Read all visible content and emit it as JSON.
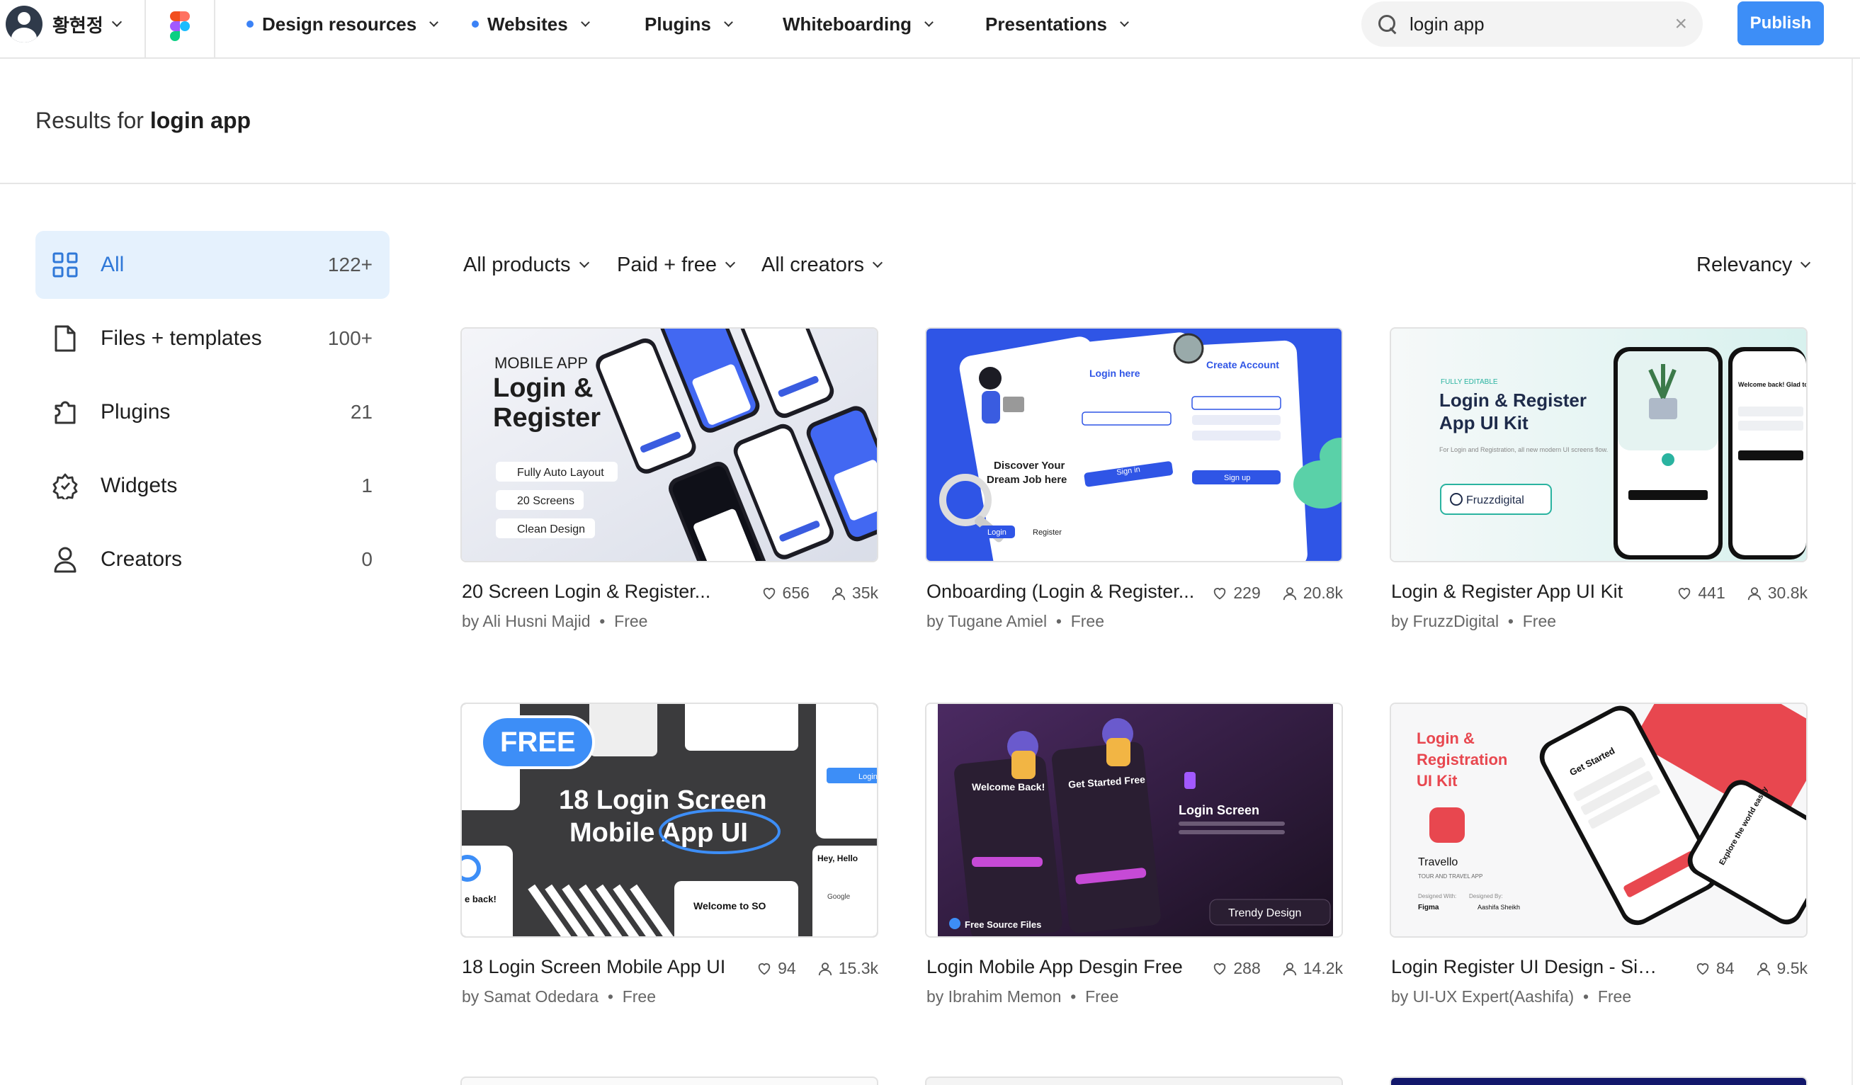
{
  "header": {
    "user_name": "황현정",
    "nav": [
      {
        "label": "Design resources",
        "dot": true
      },
      {
        "label": "Websites",
        "dot": true
      },
      {
        "label": "Plugins",
        "dot": false
      },
      {
        "label": "Whiteboarding",
        "dot": false
      },
      {
        "label": "Presentations",
        "dot": false
      }
    ],
    "search_value": "login app",
    "publish_label": "Publish"
  },
  "results": {
    "prefix": "Results for ",
    "query": "login app"
  },
  "sidebar": {
    "items": [
      {
        "label": "All",
        "count": "122+",
        "icon": "grid-icon",
        "active": true
      },
      {
        "label": "Files + templates",
        "count": "100+",
        "icon": "file-icon",
        "active": false
      },
      {
        "label": "Plugins",
        "count": "21",
        "icon": "plugin-icon",
        "active": false
      },
      {
        "label": "Widgets",
        "count": "1",
        "icon": "widget-icon",
        "active": false
      },
      {
        "label": "Creators",
        "count": "0",
        "icon": "person-icon",
        "active": false
      }
    ]
  },
  "filters": {
    "products": "All products",
    "pricing": "Paid + free",
    "creators": "All creators",
    "sort": "Relevancy"
  },
  "cards": [
    {
      "title": "20 Screen Login & Register...",
      "author": "by Ali Husni Majid",
      "price": "Free",
      "likes": "656",
      "users": "35k",
      "thumb": {
        "kicker": "MOBILE APP",
        "h1": "Login &",
        "h2": "Register",
        "chips": [
          "Fully Auto Layout",
          "20 Screens",
          "Clean Design"
        ]
      }
    },
    {
      "title": "Onboarding (Login & Register...",
      "author": "by Tugane Amiel",
      "price": "Free",
      "likes": "229",
      "users": "20.8k",
      "thumb": {
        "t1": "Discover Your",
        "t2": "Dream Job here",
        "t3": "Login here",
        "t4": "Create Account",
        "b1": "Sign in",
        "b2": "Sign up",
        "b3": "Register",
        "b4": "Login"
      }
    },
    {
      "title": "Login & Register App UI Kit",
      "author": "by FruzzDigital",
      "price": "Free",
      "likes": "441",
      "users": "30.8k",
      "thumb": {
        "kicker": "FULLY EDITABLE",
        "h1": "Login & Register",
        "h2": "App UI Kit",
        "sub": "For Login and Registration, all new modern UI screens flow.",
        "brand": "Fruzzdigital",
        "welcome": "Welcome back! Glad to see you, Again!"
      }
    },
    {
      "title": "18 Login Screen Mobile App UI",
      "author": "by Samat Odedara",
      "price": "Free",
      "likes": "94",
      "users": "15.3k",
      "thumb": {
        "badge": "FREE",
        "h1": "18 Login Screen",
        "h2": "Mobile App UI",
        "hey": "Hey, Hello",
        "welcome": "Welcome to SO",
        "back": "e back!",
        "google": "Google",
        "login": "Login"
      }
    },
    {
      "title": "Login Mobile App Desgin Free",
      "author": "by Ibrahim Memon",
      "price": "Free",
      "likes": "288",
      "users": "14.2k",
      "thumb": {
        "s1": "Welcome Back!",
        "s2": "Get Started Free",
        "h1": "Login Screen",
        "tag1": "Free Source Files",
        "tag2": "Trendy Design"
      }
    },
    {
      "title": "Login Register UI Design - Signi...",
      "author": "by UI-UX Expert(Aashifa)",
      "price": "Free",
      "likes": "84",
      "users": "9.5k",
      "thumb": {
        "h1": "Login &",
        "h2": "Registration",
        "h3": "UI Kit",
        "brand": "Travello",
        "tagline": "TOUR AND TRAVEL APP",
        "designed_with": "Designed With:",
        "tool": "Figma",
        "designed_by": "Designed By:",
        "designer": "Aashifa Sheikh",
        "phone1": "Get Started",
        "phone2": "Explore the world easily"
      }
    }
  ],
  "colors": {
    "accent": "#3d8ef7",
    "active_bg": "#e5f1fd",
    "active_text": "#2f78d8"
  }
}
